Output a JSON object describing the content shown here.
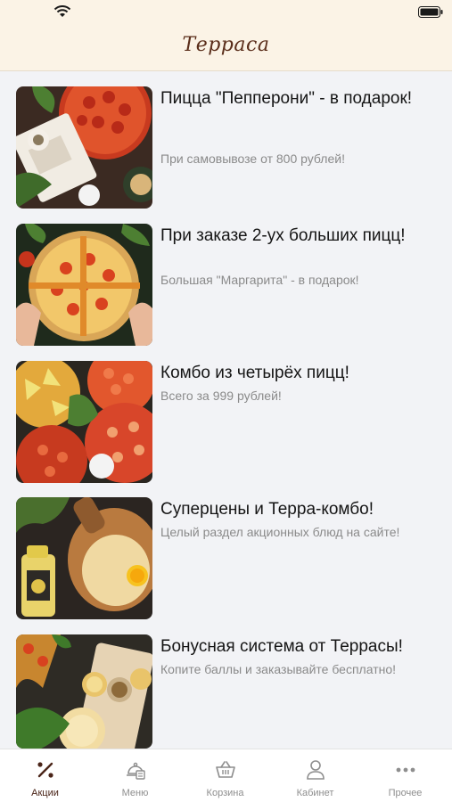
{
  "status_bar": {
    "carrier": "",
    "time": ""
  },
  "header": {
    "title": "Терраса"
  },
  "promos": [
    {
      "title": "Пицца \"Пепперони\" - в подарок!",
      "subtitle": "При самовывозе от 800 рублей!"
    },
    {
      "title": "При заказе 2-ух больших пицц!",
      "subtitle": "Большая \"Маргарита\" - в подарок!"
    },
    {
      "title": "Комбо из четырёх пицц!",
      "subtitle": "Всего за 999 рублей!"
    },
    {
      "title": "Суперцены и Терра-комбо!",
      "subtitle": "Целый раздел акционных блюд на сайте!"
    },
    {
      "title": "Бонусная система от Террасы!",
      "subtitle": "Копите баллы и заказывайте бесплатно!"
    }
  ],
  "tabbar": {
    "items": [
      {
        "label": "Акции",
        "icon": "percent-icon",
        "active": true
      },
      {
        "label": "Меню",
        "icon": "menu-dish-icon",
        "active": false
      },
      {
        "label": "Корзина",
        "icon": "basket-icon",
        "active": false
      },
      {
        "label": "Кабинет",
        "icon": "user-icon",
        "active": false
      },
      {
        "label": "Прочее",
        "icon": "more-dots-icon",
        "active": false
      }
    ]
  },
  "colors": {
    "header_bg": "#fbf3e6",
    "brand": "#5a2d1a",
    "active_tab": "#4a2418",
    "inactive_tab": "#8e8e8e",
    "subtitle": "#8a8a8a"
  }
}
